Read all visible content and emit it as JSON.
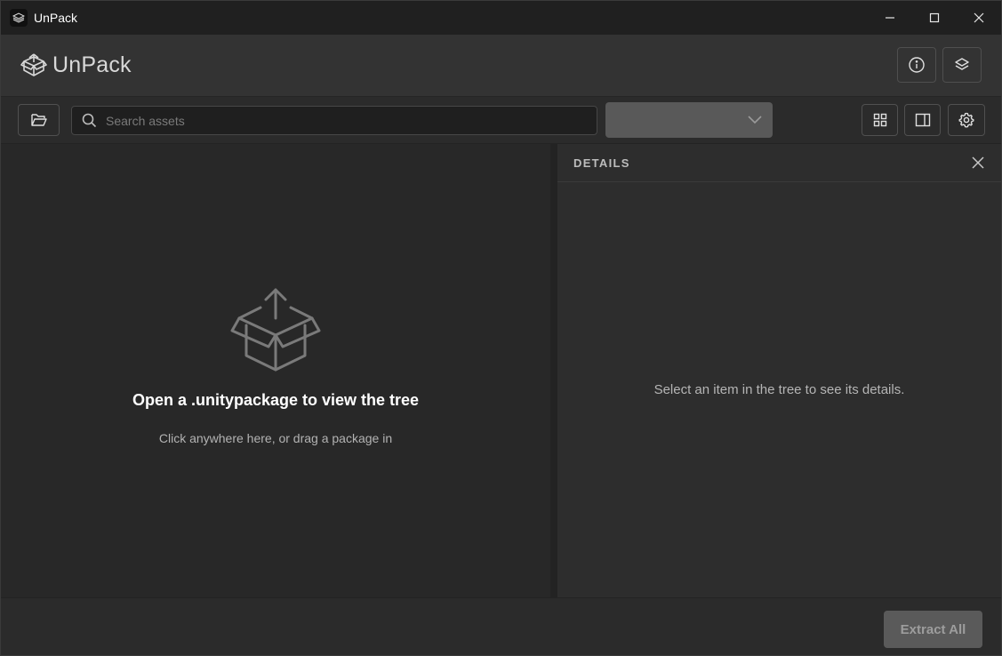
{
  "window": {
    "title": "UnPack",
    "controls": [
      "minimize-icon",
      "maximize-icon",
      "close-icon"
    ]
  },
  "header": {
    "brand": "UnPack",
    "buttons": [
      {
        "name": "info-button",
        "icon": "info-icon"
      },
      {
        "name": "layers-button",
        "icon": "layers-icon"
      }
    ]
  },
  "toolbar": {
    "open_folder_icon": "folder-open-icon",
    "search": {
      "placeholder": "Search assets",
      "value": "",
      "icon": "search-icon"
    },
    "filter_dropdown": {
      "value": "",
      "icon": "chevron-down-icon"
    },
    "right_buttons": [
      {
        "name": "grid-view-button",
        "icon": "grid-icon"
      },
      {
        "name": "toggle-details-panel-button",
        "icon": "panel-right-icon"
      },
      {
        "name": "settings-button",
        "icon": "gear-icon"
      }
    ]
  },
  "tree_panel": {
    "empty_icon": "box-upload-icon",
    "empty_title": "Open a .unitypackage to view the tree",
    "empty_subtitle": "Click anywhere here, or drag a package in"
  },
  "details_panel": {
    "title": "DETAILS",
    "empty_text": "Select an item in the tree to see its details."
  },
  "footer": {
    "extract_all_label": "Extract All"
  },
  "colors": {
    "titlebar_bg": "#202020",
    "header_bg": "#333333",
    "panel_bg": "#282828",
    "details_bg": "#2d2d2d",
    "disabled_button_bg": "#5a5a5a"
  }
}
